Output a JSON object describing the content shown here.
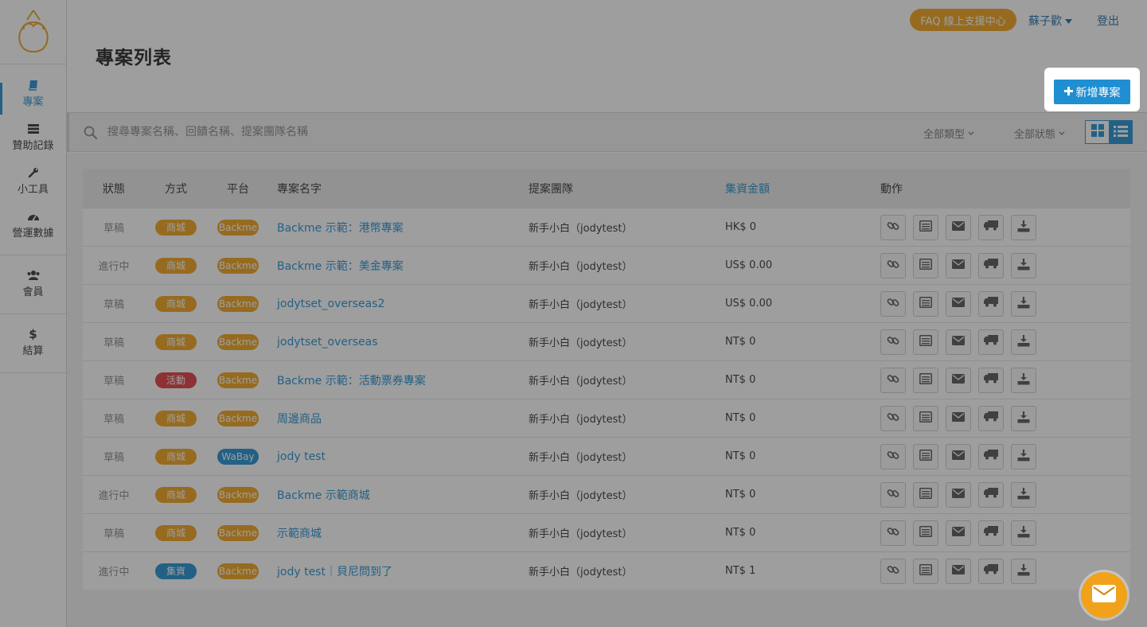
{
  "header": {
    "faq_label": "FAQ 線上支援中心",
    "user_name": "蘇子歡",
    "logout_label": "登出"
  },
  "page": {
    "title": "專案列表",
    "add_button_label": "新增專案"
  },
  "sidebar": {
    "items": [
      {
        "label": "專案",
        "icon": "book-icon",
        "active": true
      },
      {
        "label": "贊助記錄",
        "icon": "server-icon",
        "active": false
      },
      {
        "label": "小工具",
        "icon": "wrench-icon",
        "active": false
      },
      {
        "label": "營運數據",
        "icon": "dashboard-icon",
        "active": false
      },
      {
        "label": "會員",
        "icon": "users-icon",
        "active": false
      },
      {
        "label": "結算",
        "icon": "dollar-icon",
        "active": false
      }
    ]
  },
  "filters": {
    "search_placeholder": "搜尋專案名稱、回饋名稱、提案團隊名稱",
    "type_select": "全部類型",
    "status_select": "全部狀態"
  },
  "table": {
    "headers": {
      "status": "狀態",
      "type": "方式",
      "platform": "平台",
      "name": "專案名字",
      "team": "提案團隊",
      "amount": "集資金額",
      "actions": "動作"
    },
    "rows": [
      {
        "status": "草稿",
        "type": "商城",
        "type_color": "#f1a21a",
        "platform": "Backme",
        "platform_color": "#f1a21a",
        "name": "Backme 示範：港幣專案",
        "team": "新手小白（jodytest）",
        "amount": "HK$ 0"
      },
      {
        "status": "進行中",
        "type": "商城",
        "type_color": "#f1a21a",
        "platform": "Backme",
        "platform_color": "#f1a21a",
        "name": "Backme 示範：美金專案",
        "team": "新手小白（jodytest）",
        "amount": "US$ 0.00"
      },
      {
        "status": "草稿",
        "type": "商城",
        "type_color": "#f1a21a",
        "platform": "Backme",
        "platform_color": "#f1a21a",
        "name": "jodytset_overseas2",
        "team": "新手小白（jodytest）",
        "amount": "US$ 0.00"
      },
      {
        "status": "草稿",
        "type": "商城",
        "type_color": "#f1a21a",
        "platform": "Backme",
        "platform_color": "#f1a21a",
        "name": "jodytset_overseas",
        "team": "新手小白（jodytest）",
        "amount": "NT$ 0"
      },
      {
        "status": "草稿",
        "type": "活動",
        "type_color": "#e0393e",
        "platform": "Backme",
        "platform_color": "#f1a21a",
        "name": "Backme 示範：活動票券專案",
        "team": "新手小白（jodytest）",
        "amount": "NT$ 0"
      },
      {
        "status": "草稿",
        "type": "商城",
        "type_color": "#f1a21a",
        "platform": "Backme",
        "platform_color": "#f1a21a",
        "name": "周邊商品",
        "team": "新手小白（jodytest）",
        "amount": "NT$ 0"
      },
      {
        "status": "草稿",
        "type": "商城",
        "type_color": "#f1a21a",
        "platform": "WaBay",
        "platform_color": "#1f8fd1",
        "name": "jody test",
        "team": "新手小白（jodytest）",
        "amount": "NT$ 0"
      },
      {
        "status": "進行中",
        "type": "商城",
        "type_color": "#f1a21a",
        "platform": "Backme",
        "platform_color": "#f1a21a",
        "name": "Backme 示範商城",
        "team": "新手小白（jodytest）",
        "amount": "NT$ 0"
      },
      {
        "status": "草稿",
        "type": "商城",
        "type_color": "#f1a21a",
        "platform": "Backme",
        "platform_color": "#f1a21a",
        "name": "示範商城",
        "team": "新手小白（jodytest）",
        "amount": "NT$ 0"
      },
      {
        "status": "進行中",
        "type": "集資",
        "type_color": "#1f8fd1",
        "platform": "Backme",
        "platform_color": "#f1a21a",
        "name": "jody test｜貝尼問到了",
        "team": "新手小白（jodytest）",
        "amount": "NT$ 1"
      }
    ],
    "action_icons": [
      "link-icon",
      "list-alt-icon",
      "envelope-icon",
      "truck-icon",
      "download-icon"
    ]
  },
  "colors": {
    "accent": "#1f8fd1",
    "orange": "#f1a21a",
    "red": "#e0393e"
  }
}
